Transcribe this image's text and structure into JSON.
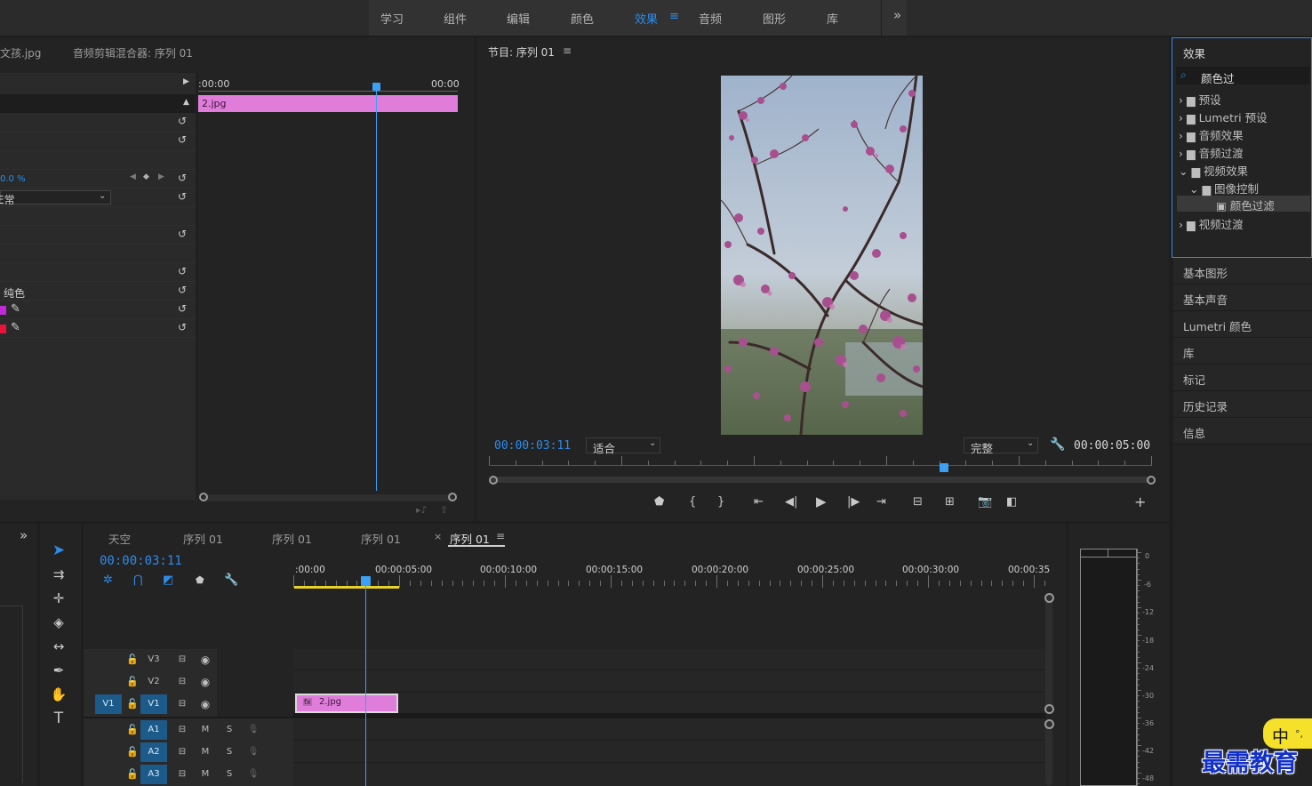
{
  "workspace": {
    "tabs": [
      "学习",
      "组件",
      "编辑",
      "颜色",
      "效果",
      "音频",
      "图形",
      "库"
    ],
    "active": "效果",
    "menu_glyph": "≡",
    "overflow": "»"
  },
  "effect_controls": {
    "source_tab": "文孩.jpg",
    "mixer_tab": "音频剪辑混合器: 序列 01",
    "time_start": ":00:00",
    "time_end": "00:00",
    "clip_label": "2.jpg",
    "value_percent": "0.0 %",
    "blend_mode": "E常",
    "solid_label": "纯色"
  },
  "program_monitor": {
    "title": "节目: 序列 01",
    "menu_glyph": "≡",
    "current_time": "00:00:03:11",
    "zoom": "适合",
    "quality": "完整",
    "duration": "00:00:05:00"
  },
  "effects_panel": {
    "title": "效果",
    "search_value": "颜色过",
    "tree": [
      {
        "label": "预设",
        "level": 0,
        "expanded": false
      },
      {
        "label": "Lumetri 预设",
        "level": 0,
        "expanded": false
      },
      {
        "label": "音频效果",
        "level": 0,
        "expanded": false
      },
      {
        "label": "音频过渡",
        "level": 0,
        "expanded": false
      },
      {
        "label": "视频效果",
        "level": 0,
        "expanded": true
      },
      {
        "label": "图像控制",
        "level": 1,
        "expanded": true
      },
      {
        "label": "颜色过滤",
        "level": 2,
        "selected": true
      },
      {
        "label": "视频过渡",
        "level": 0,
        "expanded": false
      }
    ]
  },
  "side_panels": [
    "基本图形",
    "基本声音",
    "Lumetri 颜色",
    "库",
    "标记",
    "历史记录",
    "信息"
  ],
  "timeline": {
    "tabs": [
      "天空",
      "序列 01",
      "序列 01",
      "序列 01",
      "序列 01"
    ],
    "active_tab_index": 4,
    "close_glyph": "×",
    "menu_glyph": "≡",
    "current_time": "00:00:03:11",
    "ruler_labels": [
      ":00:00",
      "00:00:05:00",
      "00:00:10:00",
      "00:00:15:00",
      "00:00:20:00",
      "00:00:25:00",
      "00:00:30:00",
      "00:00:35"
    ],
    "video_tracks": [
      "V3",
      "V2",
      "V1"
    ],
    "audio_tracks": [
      "A1",
      "A2",
      "A3"
    ],
    "source_patch": "V1",
    "mute": "M",
    "solo": "S",
    "clip_label": "2.jpg",
    "clip_fx": "fx"
  },
  "meter": {
    "scale": [
      "0",
      "-6",
      "-12",
      "-18",
      "-24",
      "-30",
      "-36",
      "-42",
      "-48"
    ]
  },
  "ime": {
    "glyph": "中",
    "punct": "°,"
  },
  "watermark": {
    "text": "最需教育"
  },
  "colors": {
    "accent": "#2d8ceb",
    "clip_pink": "#e07ddb",
    "panel_bg": "#232323",
    "work_area_yellow": "#e8d22a"
  }
}
